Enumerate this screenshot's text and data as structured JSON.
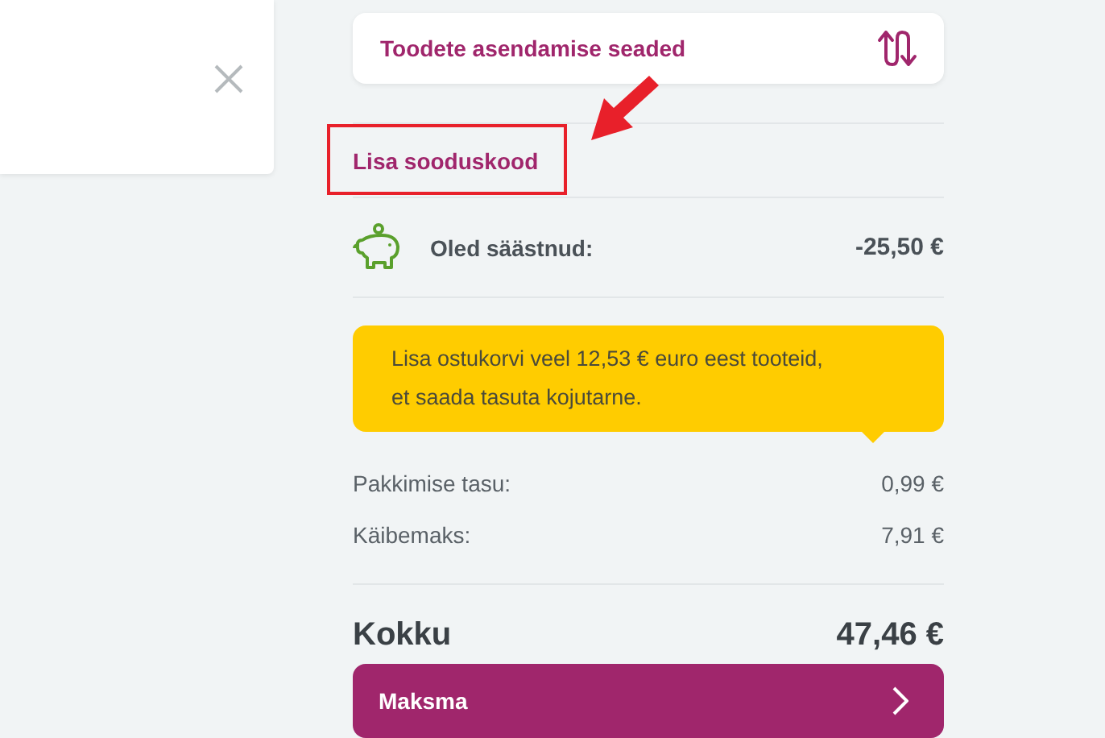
{
  "replacement_settings": {
    "label": "Toodete asendamise seaded"
  },
  "promo_link": {
    "label": "Lisa sooduskood",
    "highlighted": true
  },
  "savings": {
    "label": "Oled säästnud:",
    "amount": "-25,50 €"
  },
  "notice": {
    "text": "Lisa ostukorvi veel 12,53 € euro eest tooteid,\net saada tasuta kojutarne."
  },
  "fees": [
    {
      "label": "Pakkimise tasu:",
      "amount": "0,99 €"
    },
    {
      "label": "Käibemaks:",
      "amount": "7,91 €"
    }
  ],
  "total": {
    "label": "Kokku",
    "amount": "47,46 €"
  },
  "pay_button": {
    "label": "Maksma"
  }
}
